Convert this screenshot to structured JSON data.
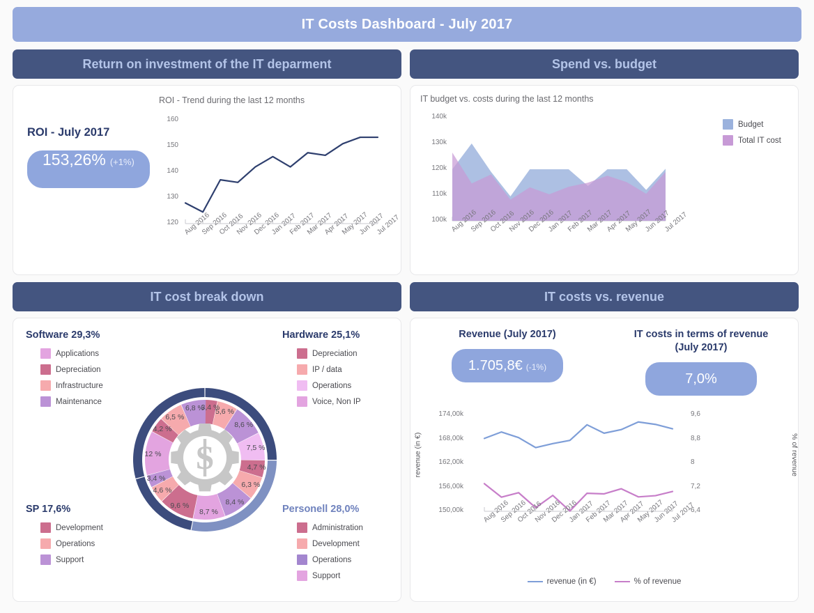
{
  "title": "IT Costs Dashboard - July 2017",
  "colors": {
    "title_bar": "#96aadd",
    "panel_head": "#445580",
    "panel_head_text": "#b3c4e8",
    "accent_pill": "#8fa6dd",
    "roi_line": "#2e3f6e",
    "budget_area": "#9bb2dd",
    "cost_area": "#c79ad6",
    "revenue_line": "#7e9ed8",
    "percent_line": "#c77ec9",
    "ring_dark": "#3c4c7d",
    "ring_light": "#7f91c2"
  },
  "panels": {
    "roi": {
      "header": "Return on investment of the IT deparment"
    },
    "spend": {
      "header": "Spend vs. budget"
    },
    "breakdown": {
      "header": "IT cost break down"
    },
    "revenue": {
      "header": "IT costs vs. revenue"
    }
  },
  "roi_kpi": {
    "label": "ROI - July 2017",
    "value": "153,26%",
    "delta": "(+1%)"
  },
  "revenue_kpi": {
    "label": "Revenue (July 2017)",
    "value": "1.705,8€",
    "delta": "(-1%)"
  },
  "costs_kpi": {
    "label_line1": "IT costs in terms of revenue",
    "label_line2": "(July 2017)",
    "value": "7,0%"
  },
  "breakdown_legends": [
    {
      "title": "Software 29,3%",
      "title_color": "#2a3a6b",
      "items": [
        {
          "label": "Applications",
          "color": "#e3a4e0"
        },
        {
          "label": "Depreciation",
          "color": "#cc6e8e"
        },
        {
          "label": "Infrastructure",
          "color": "#f6aaad"
        },
        {
          "label": "Maintenance",
          "color": "#bb92d6"
        }
      ]
    },
    {
      "title": "Hardware 25,1%",
      "title_color": "#2a3a6b",
      "items": [
        {
          "label": "Depreciation",
          "color": "#cc6e8e"
        },
        {
          "label": "IP / data",
          "color": "#f6aaad"
        },
        {
          "label": "Operations",
          "color": "#f0bdf2"
        },
        {
          "label": "Voice, Non IP",
          "color": "#e3a4e0"
        }
      ]
    },
    {
      "title": "SP 17,6%",
      "title_color": "#2a3a6b",
      "items": [
        {
          "label": "Development",
          "color": "#cc6e8e"
        },
        {
          "label": "Operations",
          "color": "#f6aaad"
        },
        {
          "label": "Support",
          "color": "#bb92d6"
        }
      ]
    },
    {
      "title": "Personell 28,0%",
      "title_color": "#6f82bd",
      "items": [
        {
          "label": "Administration",
          "color": "#cc6e8e"
        },
        {
          "label": "Development",
          "color": "#f6aaad"
        },
        {
          "label": "Operations",
          "color": "#a386cf"
        },
        {
          "label": "Support",
          "color": "#e3a4e0"
        }
      ]
    }
  ],
  "chart_data": [
    {
      "type": "line",
      "id": "roi_trend",
      "title": "ROI - Trend during the last 12 months",
      "xlabel": "",
      "ylabel": "",
      "ylim": [
        120,
        160
      ],
      "yticks": [
        120,
        130,
        140,
        150,
        160
      ],
      "grid": false,
      "categories": [
        "Aug 2016",
        "Sep 2016",
        "Oct 2016",
        "Nov 2016",
        "Dec 2016",
        "Jan 2017",
        "Feb 2017",
        "Mar 2017",
        "Apr 2017",
        "May 2017",
        "Jun 2017",
        "Jul 2017"
      ],
      "series": [
        {
          "name": "ROI",
          "color": "#2e3f6e",
          "values": [
            128.0,
            124.5,
            137.0,
            136.0,
            142.0,
            146.0,
            142.0,
            147.5,
            146.5,
            151.0,
            153.5,
            153.5
          ]
        }
      ]
    },
    {
      "type": "area",
      "id": "budget_vs_cost",
      "title": "IT budget vs. costs during the last 12 months",
      "xlabel": "",
      "ylabel": "",
      "ylim": [
        100000,
        140000
      ],
      "yticks": [
        "100k",
        "110k",
        "120k",
        "130k",
        "140k"
      ],
      "grid": false,
      "legend_position": "right",
      "categories": [
        "Aug 2016",
        "Sep 2016",
        "Oct 2016",
        "Nov 2016",
        "Dec 2016",
        "Jan 2017",
        "Feb 2017",
        "Mar 2017",
        "Apr 2017",
        "May 2017",
        "Jun 2017",
        "Jul 2017"
      ],
      "series": [
        {
          "name": "Budget",
          "color": "#9bb2dd",
          "values": [
            120000,
            130000,
            119000,
            109500,
            120000,
            120000,
            120000,
            113500,
            120000,
            120000,
            112000,
            120200
          ]
        },
        {
          "name": "Total IT cost",
          "color": "#c79ad6",
          "values": [
            126500,
            114500,
            118000,
            108200,
            113000,
            110300,
            113200,
            114800,
            117500,
            115000,
            110500,
            119000
          ]
        }
      ]
    },
    {
      "type": "pie",
      "id": "it_cost_breakdown",
      "title": "IT cost break down",
      "note": "Inner ring = sub-categories, outer ring = 4 main categories",
      "outer_groups": [
        {
          "name": "Hardware",
          "value": 25.1,
          "color": "#3c4c7d"
        },
        {
          "name": "Personell",
          "value": 28.0,
          "color": "#7f91c2"
        },
        {
          "name": "SP",
          "value": 17.6,
          "color": "#3c4c7d"
        },
        {
          "name": "Software",
          "value": 29.3,
          "color": "#3c4c7d"
        }
      ],
      "labels": [
        "3,4 %",
        "5,6 %",
        "8,6 %",
        "7,5 %",
        "4,7 %",
        "6,3 %",
        "8,4 %",
        "8,7 %",
        "9,6 %",
        "4,6 %",
        "3,4 %",
        "12 %",
        "4,2 %",
        "6,5 %",
        "6,8 %"
      ],
      "values": [
        3.4,
        5.6,
        8.6,
        7.5,
        4.7,
        6.3,
        8.4,
        8.7,
        9.6,
        4.6,
        3.4,
        12.0,
        4.2,
        6.5,
        6.8
      ],
      "slice_colors": [
        "#cc6e8e",
        "#f6aaad",
        "#bb92d6",
        "#f0bdf2",
        "#cc6e8e",
        "#f6aaad",
        "#bb92d6",
        "#e3a4e0",
        "#cc6e8e",
        "#f6aaad",
        "#bb92d6",
        "#e3a4e0",
        "#cc6e8e",
        "#f6aaad",
        "#bb92d6"
      ]
    },
    {
      "type": "line",
      "id": "costs_vs_revenue",
      "title": "",
      "xlabel": "",
      "ylabel": "revenue (in €)",
      "y2label": "% of revenue",
      "ylim": [
        150000,
        174000
      ],
      "yticks": [
        "150,00k",
        "156,00k",
        "162,00k",
        "168,00k",
        "174,00k"
      ],
      "y2lim": [
        6.4,
        9.6
      ],
      "y2ticks": [
        "6,4",
        "7,2",
        "8",
        "8,8",
        "9,6"
      ],
      "grid": false,
      "legend_position": "bottom",
      "categories": [
        "Aug 2016",
        "Sep 2016",
        "Oct 2016",
        "Nov 2016",
        "Dec 2016",
        "Jan 2017",
        "Feb 2017",
        "Mar 2017",
        "Apr 2017",
        "May 2017",
        "Jun 2017",
        "Jul 2017"
      ],
      "series": [
        {
          "name": "revenue (in €)",
          "color": "#7e9ed8",
          "axis": "left",
          "values": [
            168200,
            169800,
            168400,
            165900,
            166900,
            167700,
            171600,
            169500,
            170400,
            172300,
            171700,
            170600
          ]
        },
        {
          "name": "% of revenue",
          "color": "#c77ec9",
          "axis": "right",
          "values": [
            7.32,
            6.87,
            7.02,
            6.52,
            6.93,
            6.41,
            7.0,
            6.98,
            7.15,
            6.88,
            6.92,
            7.06
          ]
        }
      ]
    }
  ]
}
